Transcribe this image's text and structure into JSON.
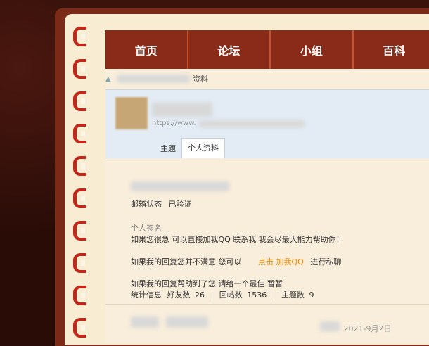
{
  "nav": {
    "items": [
      "首页",
      "论坛",
      "小组",
      "百科"
    ]
  },
  "breadcrumb": {
    "last": "资料"
  },
  "profile": {
    "url_prefix": "https://www.",
    "tabs": [
      "主题",
      "个人资料"
    ],
    "active_tab": "个人资料"
  },
  "info": {
    "email_label": "邮箱状态",
    "email_value": "已验证",
    "signature_label": "个人签名",
    "signature_line1": "如果您很急 可以直接加我QQ 联系我 我会尽最大能力帮助你！",
    "signature_line2_prefix": "如果我的回复您并不满意 您可以",
    "signature_link": "点击 加我QQ",
    "signature_line2_suffix": "进行私聊",
    "signature_line3": "如果我的回复帮助到了您 请给一个最佳 暂暂"
  },
  "stats": {
    "label": "统计信息",
    "friends_label": "好友数",
    "friends": "26",
    "replies_label": "回帖数",
    "replies": "1536",
    "topics_label": "主题数",
    "topics": "9"
  },
  "footer": {
    "date_partial": "2021-9月2日"
  },
  "colors": {
    "nav_bg": "#8a2a18",
    "stitch": "#c0281c",
    "page_bg": "#f9eedb",
    "profile_bg": "#e3ebf4",
    "link_orange": "#f08a00"
  }
}
